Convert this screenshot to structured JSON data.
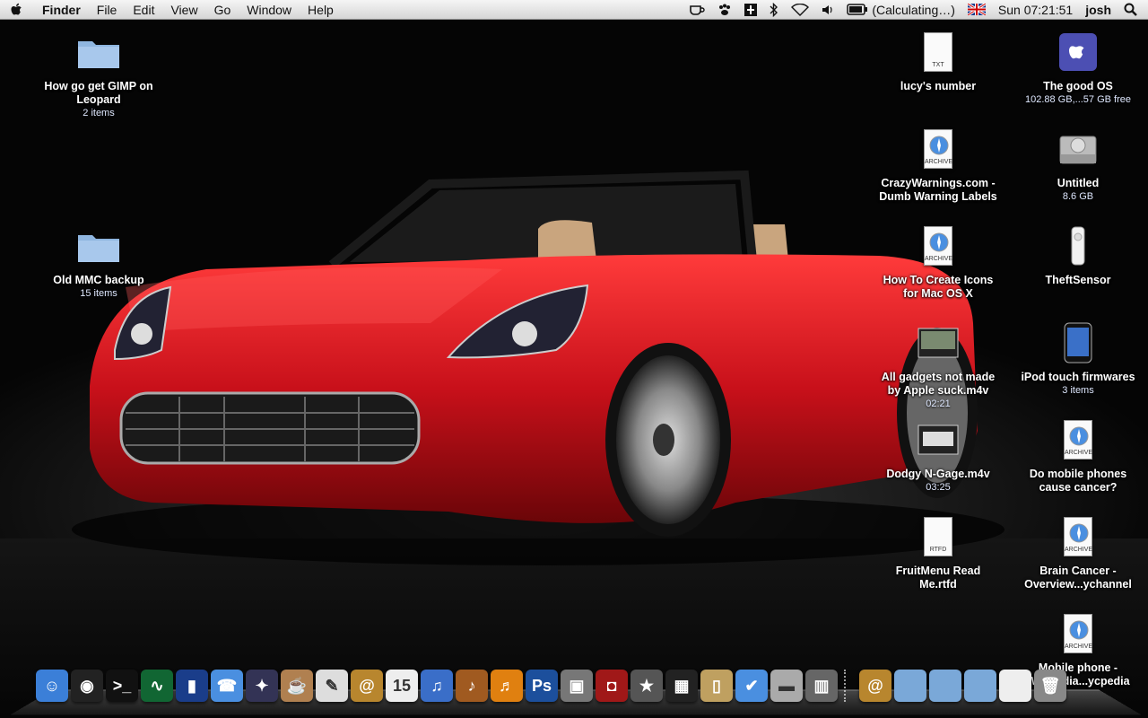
{
  "menubar": {
    "app_name": "Finder",
    "menus": [
      "File",
      "Edit",
      "View",
      "Go",
      "Window",
      "Help"
    ],
    "battery_text": "(Calculating…)",
    "clock": "Sun 07:21:51",
    "user": "josh"
  },
  "desktop_left": [
    {
      "label": "How go get GIMP on Leopard",
      "sub": "2 items"
    },
    {
      "label": "Old MMC backup",
      "sub": "15 items"
    }
  ],
  "desktop_right_col1": [
    {
      "label": "lucy's number",
      "sub": "",
      "tag": "TXT"
    },
    {
      "label": "CrazyWarnings.com - Dumb Warning Labels",
      "sub": "",
      "tag": "ARCHIVE"
    },
    {
      "label": "How To Create Icons for Mac OS X",
      "sub": "",
      "tag": "ARCHIVE"
    },
    {
      "label": "All gadgets not made by Apple suck.m4v",
      "sub": "02:21"
    },
    {
      "label": "Dodgy N-Gage.m4v",
      "sub": "03:25"
    },
    {
      "label": "FruitMenu Read Me.rtfd",
      "sub": "",
      "tag": "RTFD"
    }
  ],
  "desktop_right_col2": [
    {
      "label": "The good OS",
      "sub": "102.88 GB,...57 GB free"
    },
    {
      "label": "Untitled",
      "sub": "8.6 GB"
    },
    {
      "label": "TheftSensor",
      "sub": ""
    },
    {
      "label": "iPod touch firmwares",
      "sub": "3 items"
    },
    {
      "label": "Do mobile phones cause cancer?",
      "sub": "",
      "tag": "ARCHIVE"
    },
    {
      "label": "Brain Cancer - Overview...ychannel",
      "sub": "",
      "tag": "ARCHIVE"
    },
    {
      "label": "Mobile phone - Wikipedia...ycpedia",
      "sub": "",
      "tag": "ARCHIVE"
    }
  ],
  "dock": {
    "apps": [
      {
        "name": "finder-dock-icon",
        "color": "#3b7fd8",
        "glyph": "☺"
      },
      {
        "name": "dashboard-dock-icon",
        "color": "#222",
        "glyph": "◉"
      },
      {
        "name": "terminal-dock-icon",
        "color": "#111",
        "glyph": ">_"
      },
      {
        "name": "activity-monitor-dock-icon",
        "color": "#163",
        "glyph": "∿"
      },
      {
        "name": "tardis-dock-icon",
        "color": "#1a3d8a",
        "glyph": "▮"
      },
      {
        "name": "ichat-dock-icon",
        "color": "#4a8fe0",
        "glyph": "☎"
      },
      {
        "name": "ninja-dock-icon",
        "color": "#335",
        "glyph": "✦"
      },
      {
        "name": "coffee-dock-icon",
        "color": "#b08050",
        "glyph": "☕"
      },
      {
        "name": "textedit-dock-icon",
        "color": "#ddd",
        "glyph": "✎"
      },
      {
        "name": "address-book-dock-icon",
        "color": "#b8862e",
        "glyph": "@"
      },
      {
        "name": "ical-dock-icon",
        "color": "#eee",
        "glyph": "15"
      },
      {
        "name": "itunes-dock-icon",
        "color": "#3a6ec8",
        "glyph": "♫"
      },
      {
        "name": "garageband-dock-icon",
        "color": "#a05a20",
        "glyph": "♪"
      },
      {
        "name": "audacity-dock-icon",
        "color": "#e08010",
        "glyph": "♬"
      },
      {
        "name": "photoshop-dock-icon",
        "color": "#1c4f9c",
        "glyph": "Ps"
      },
      {
        "name": "iphoto-dock-icon",
        "color": "#777",
        "glyph": "▣"
      },
      {
        "name": "photo-booth-dock-icon",
        "color": "#a01818",
        "glyph": "◘"
      },
      {
        "name": "imovie-dock-icon",
        "color": "#555",
        "glyph": "★"
      },
      {
        "name": "clapper-dock-icon",
        "color": "#222",
        "glyph": "▦"
      },
      {
        "name": "preview-dock-icon",
        "color": "#bfa060",
        "glyph": "▯"
      },
      {
        "name": "system-prefs-dock-icon",
        "color": "#4a8fe0",
        "glyph": "✔"
      },
      {
        "name": "drive-dock-icon",
        "color": "#aaa",
        "glyph": "▬"
      },
      {
        "name": "equalizer-dock-icon",
        "color": "#666",
        "glyph": "▥"
      }
    ],
    "docs": [
      {
        "name": "address-stack-dock-icon",
        "color": "#b8862e",
        "glyph": "@"
      },
      {
        "name": "folder-stack-dock-icon",
        "color": "#7aa8d8",
        "glyph": ""
      },
      {
        "name": "downloads-stack-dock-icon",
        "color": "#7aa8d8",
        "glyph": ""
      },
      {
        "name": "documents-stack-dock-icon",
        "color": "#7aa8d8",
        "glyph": ""
      },
      {
        "name": "file-stack-dock-icon",
        "color": "#eee",
        "glyph": ""
      },
      {
        "name": "trash-dock-icon",
        "color": "#888",
        "glyph": "🗑"
      }
    ]
  },
  "colors": {
    "car": "#c8101a",
    "folder": "#8fb6e0"
  }
}
